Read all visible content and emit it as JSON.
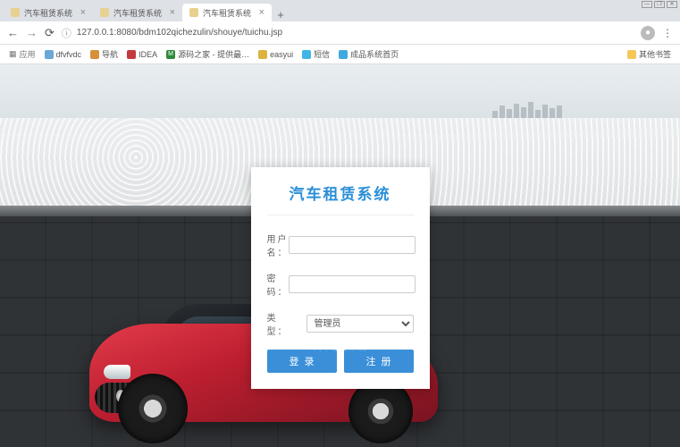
{
  "window": {
    "min": "—",
    "max": "❐",
    "close": "✕"
  },
  "tabs": {
    "items": [
      {
        "title": "汽车租赁系统",
        "active": false
      },
      {
        "title": "汽车租赁系统",
        "active": false
      },
      {
        "title": "汽车租赁系统",
        "active": true
      }
    ],
    "new_tab": "+"
  },
  "addr": {
    "back": "←",
    "forward": "→",
    "reload": "⟳",
    "info_icon": "ⓘ",
    "url": "127.0.0.1:8080/bdm102qichezulin/shouye/tuichu.jsp",
    "avatar": "●",
    "menu": "⋮"
  },
  "bookmarks": {
    "apps": "应用",
    "items": [
      {
        "label": "dfvfvdc",
        "color": "#6aa7d6"
      },
      {
        "label": "导航",
        "color": "#d7903a"
      },
      {
        "label": "IDEA",
        "color": "#c43a3a"
      },
      {
        "label": "源码之家 - 提供最…",
        "color": "#2f8a3b",
        "badge": "M"
      },
      {
        "label": "easyui",
        "color": "#dcb33c"
      },
      {
        "label": "短信",
        "color": "#40b5e6"
      },
      {
        "label": "成品系统首页",
        "color": "#3fa9df"
      }
    ],
    "other": "其他书签"
  },
  "login": {
    "title": "汽车租赁系统",
    "username_label": "用户名：",
    "password_label": "密　码：",
    "type_label": "类　型：",
    "type_value": "管理员",
    "login_btn": "登录",
    "register_btn": "注册"
  },
  "watermark": "汽车租赁系统"
}
